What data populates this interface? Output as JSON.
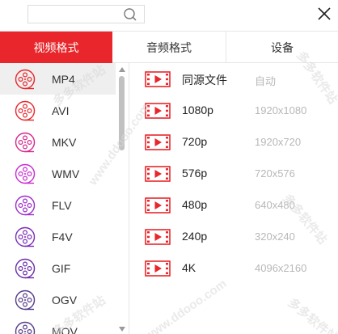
{
  "search": {
    "value": "",
    "placeholder": ""
  },
  "tabs": [
    {
      "label": "视频格式",
      "active": true
    },
    {
      "label": "音频格式",
      "active": false
    },
    {
      "label": "设备",
      "active": false
    }
  ],
  "formats": [
    {
      "label": "MP4",
      "selected": true,
      "color": "#e8262b"
    },
    {
      "label": "AVI",
      "selected": false,
      "color": "#e8262b"
    },
    {
      "label": "MKV",
      "selected": false,
      "color": "#d6268e"
    },
    {
      "label": "WMV",
      "selected": false,
      "color": "#c82bd2"
    },
    {
      "label": "FLV",
      "selected": false,
      "color": "#9b2bc9"
    },
    {
      "label": "F4V",
      "selected": false,
      "color": "#7b2bb8"
    },
    {
      "label": "GIF",
      "selected": false,
      "color": "#6a2ca8"
    },
    {
      "label": "OGV",
      "selected": false,
      "color": "#553a8a"
    },
    {
      "label": "MOV",
      "selected": false,
      "color": "#553a8a"
    }
  ],
  "resolutions": [
    {
      "name": "同源文件",
      "res": "自动"
    },
    {
      "name": "1080p",
      "res": "1920x1080"
    },
    {
      "name": "720p",
      "res": "1920x720"
    },
    {
      "name": "576p",
      "res": "720x576"
    },
    {
      "name": "480p",
      "res": "640x480"
    },
    {
      "name": "240p",
      "res": "320x240"
    },
    {
      "name": "4K",
      "res": "4096x2160"
    }
  ],
  "watermark": {
    "site": "www.ddooo.com",
    "brand": "多多软件站"
  },
  "colors": {
    "accent": "#e8262b",
    "muted": "#b8b8b8"
  }
}
